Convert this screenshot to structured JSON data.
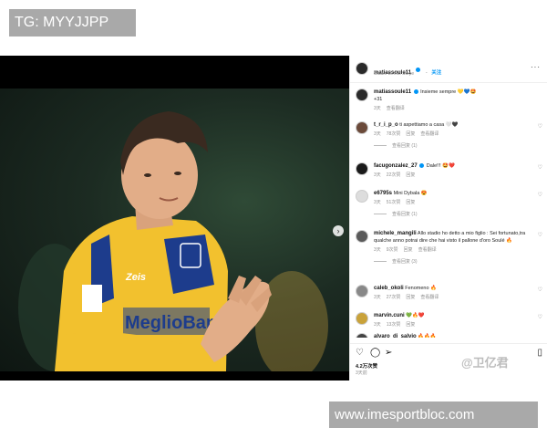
{
  "tag_label": "TG: MYYJJPP",
  "site_label": "www.imesportbloc.com",
  "post": {
    "username": "matiassoule11",
    "follow": "关注",
    "location": "Stadio Benito Stirpe",
    "caption": {
      "username": "matiassoule11",
      "text": "Insieme sempre 💛💙🤩",
      "tags": "+31",
      "time": "3天",
      "translate": "查看翻译"
    },
    "comments": [
      {
        "username": "t_r_i_p_o",
        "text": "ti aspettiamo a casa 🤍🖤",
        "time": "3天",
        "likes": "78次赞",
        "reply": "回复",
        "translate": "查看翻译",
        "replies": "查看回复 (1)"
      },
      {
        "username": "facugonzalez_27",
        "text": "Dale!!! 🤩❤️",
        "time": "3天",
        "likes": "22次赞",
        "reply": "回复",
        "translate": "",
        "replies": ""
      },
      {
        "username": "e6795s",
        "text": "Mini Dybala 😍",
        "time": "3天",
        "likes": "51次赞",
        "reply": "回复",
        "translate": "",
        "replies": "查看回复 (1)"
      },
      {
        "username": "michele_mangili",
        "text": "Allo stadio ho detto a mio figlio : Sei fortunato,tra qualche anno potrai dire che hai visto il pallone d'oro Soulé 🔥",
        "time": "3天",
        "likes": "9次赞",
        "reply": "回复",
        "translate": "查看翻译",
        "replies": "查看回复 (3)"
      },
      {
        "username": "caleb_okoli",
        "text": "Fenomeno 🔥",
        "time": "3天",
        "likes": "27次赞",
        "reply": "回复",
        "translate": "查看翻译",
        "replies": ""
      },
      {
        "username": "marvin.cuni",
        "text": "💚🔥❤️",
        "time": "3天",
        "likes": "13次赞",
        "reply": "回复",
        "translate": "",
        "replies": ""
      },
      {
        "username": "alvaro_di_salvio",
        "text": "🔥🔥🔥",
        "time": "",
        "likes": "",
        "reply": "",
        "translate": "",
        "replies": ""
      }
    ],
    "likes_count": "4.2万次赞",
    "posted": "3天前",
    "watermark": "@卫亿君"
  },
  "colors": {
    "accent": "#0095f6",
    "label_box": "#a9a9a9",
    "jersey": "#f2c12e"
  }
}
